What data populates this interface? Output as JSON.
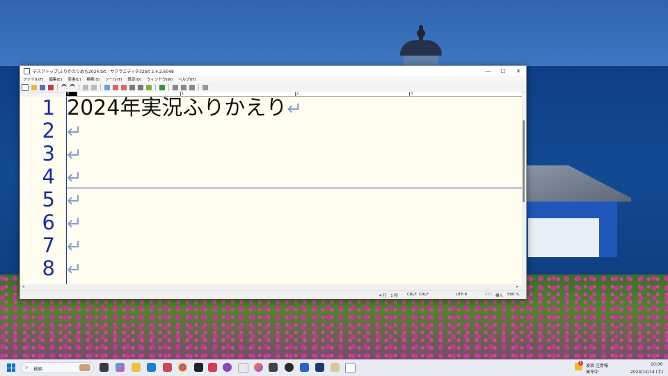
{
  "window": {
    "title": "デスクトップ\\ふりかえりめも2024.txt - サクラエディタ32bit 2.4.2.6048",
    "minimize": "—",
    "maximize": "☐",
    "close": "✕"
  },
  "menu": [
    "ファイル(F)",
    "編集(E)",
    "変換(C)",
    "検索(S)",
    "ツール(T)",
    "設定(O)",
    "ウィンドウ(W)",
    "ヘルプ(H)"
  ],
  "ruler": {
    "marks": [
      "0",
      "1",
      "2",
      "3"
    ]
  },
  "editor": {
    "line_numbers": [
      "1",
      "2",
      "3",
      "4",
      "5",
      "6",
      "7",
      "8"
    ],
    "lines": [
      "2024年実況ふりかえり",
      "",
      "",
      "",
      "",
      "",
      "",
      ""
    ],
    "eol_glyph": "↵"
  },
  "status": {
    "position": "4 行　1 桁",
    "eol1": "CRLF",
    "eol2": "CRLF",
    "encoding": "UTF-8",
    "rec": "REC",
    "mode": "挿入",
    "zoom": "500 %"
  },
  "taskbar": {
    "search_placeholder": "検索",
    "weather_title": "波浪 注意報",
    "weather_sub": "発令中",
    "weather_badge": "1",
    "time": "10:06",
    "date": "2024/12/14 (土)"
  }
}
